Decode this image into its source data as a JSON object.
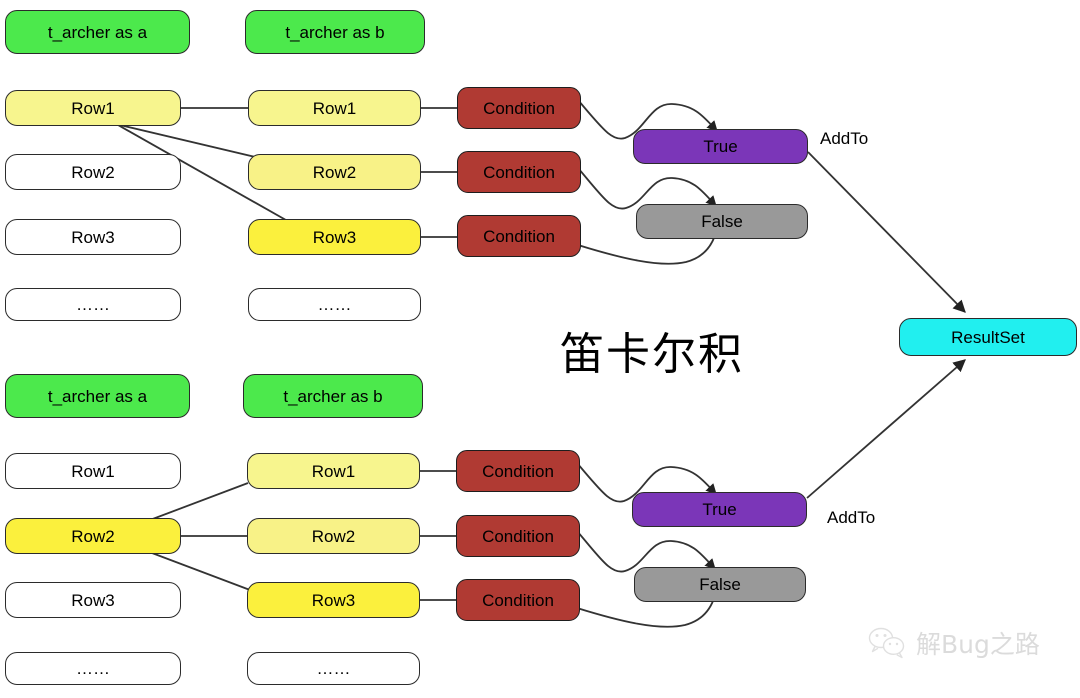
{
  "diagram": {
    "title_cjk": "笛卡尔积",
    "watermark": {
      "text": "解Bug之路",
      "icon": "wechat-icon"
    }
  },
  "groups": [
    {
      "id": "top",
      "left_table_header": "t_archer as a",
      "right_table_header": "t_archer as b",
      "left_rows": [
        {
          "label": "Row1",
          "highlight": "yellow-pale"
        },
        {
          "label": "Row2",
          "highlight": "plain"
        },
        {
          "label": "Row3",
          "highlight": "plain"
        },
        {
          "label": "……",
          "highlight": "plain"
        }
      ],
      "right_rows": [
        {
          "label": "Row1",
          "highlight": "yellow-pale"
        },
        {
          "label": "Row2",
          "highlight": "yellow-mid"
        },
        {
          "label": "Row3",
          "highlight": "yellow-str"
        },
        {
          "label": "……",
          "highlight": "plain"
        }
      ],
      "conditions": [
        "Condition",
        "Condition",
        "Condition"
      ],
      "outcome_true": "True",
      "outcome_false": "False",
      "add_to_label": "AddTo"
    },
    {
      "id": "bottom",
      "left_table_header": "t_archer as a",
      "right_table_header": "t_archer as b",
      "left_rows": [
        {
          "label": "Row1",
          "highlight": "plain"
        },
        {
          "label": "Row2",
          "highlight": "yellow-str"
        },
        {
          "label": "Row3",
          "highlight": "plain"
        },
        {
          "label": "……",
          "highlight": "plain"
        }
      ],
      "right_rows": [
        {
          "label": "Row1",
          "highlight": "yellow-pale"
        },
        {
          "label": "Row2",
          "highlight": "yellow-mid"
        },
        {
          "label": "Row3",
          "highlight": "yellow-str"
        },
        {
          "label": "……",
          "highlight": "plain"
        }
      ],
      "conditions": [
        "Condition",
        "Condition",
        "Condition"
      ],
      "outcome_true": "True",
      "outcome_false": "False",
      "add_to_label": "AddTo"
    }
  ],
  "result_node": {
    "label": "ResultSet"
  },
  "colors": {
    "table_header_green": "#4ce94c",
    "row_yellow_pale": "#f7f58e",
    "row_yellow_strong": "#fbf03d",
    "condition_red": "#b03a33",
    "true_purple": "#7b36b8",
    "false_gray": "#999999",
    "result_cyan": "#21efef",
    "edge_stroke": "#333333",
    "node_border": "#2b2b2b"
  }
}
